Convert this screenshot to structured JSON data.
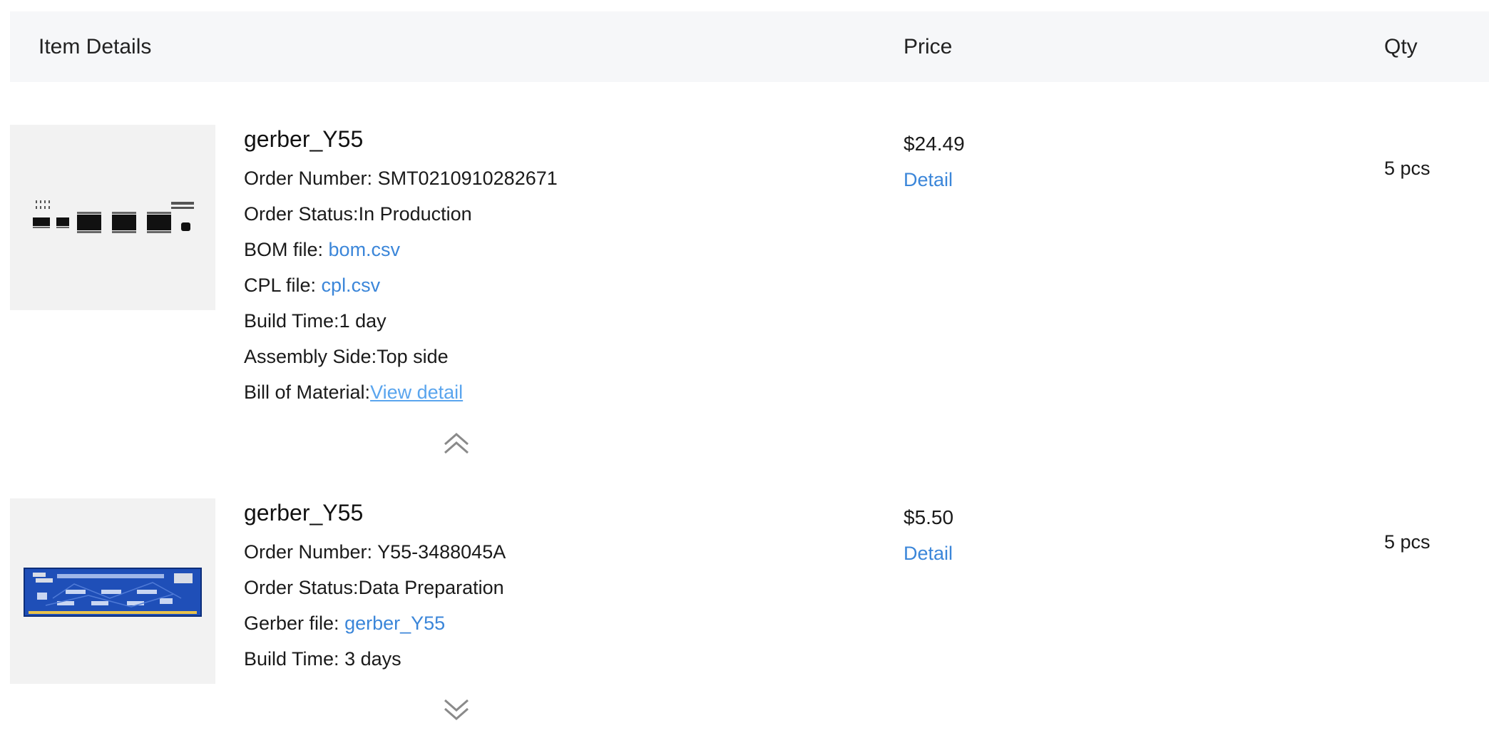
{
  "header": {
    "item_details": "Item Details",
    "price": "Price",
    "qty": "Qty"
  },
  "orders": [
    {
      "title": "gerber_Y55",
      "order_number_label": "Order Number: ",
      "order_number": "SMT0210910282671",
      "status_label": "Order Status:",
      "status": "In Production",
      "bom_label": "BOM file: ",
      "bom_file": "bom.csv",
      "cpl_label": "CPL file: ",
      "cpl_file": "cpl.csv",
      "build_label": "Build Time:",
      "build_time": "1 day",
      "side_label": "Assembly Side:",
      "side": "Top side",
      "bill_label": "Bill of Material:",
      "bill_link": "View detail",
      "price": "$24.49",
      "detail": "Detail",
      "qty": "5 pcs",
      "toggle_icon": "chevron-double-up-icon"
    },
    {
      "title": "gerber_Y55",
      "order_number_label": "Order Number: ",
      "order_number": "Y55-3488045A",
      "status_label": "Order Status:",
      "status": "Data Preparation",
      "gerber_label": "Gerber file: ",
      "gerber_file": "gerber_Y55",
      "build_label": "Build Time: ",
      "build_time": "3 days",
      "price": "$5.50",
      "detail": "Detail",
      "qty": "5 pcs",
      "toggle_icon": "chevron-double-down-icon"
    }
  ],
  "colors": {
    "link": "#3b86d9",
    "header_bg": "#f6f7f9",
    "thumb_bg": "#f2f2f2",
    "pcb_blue": "#1f4fb8"
  }
}
